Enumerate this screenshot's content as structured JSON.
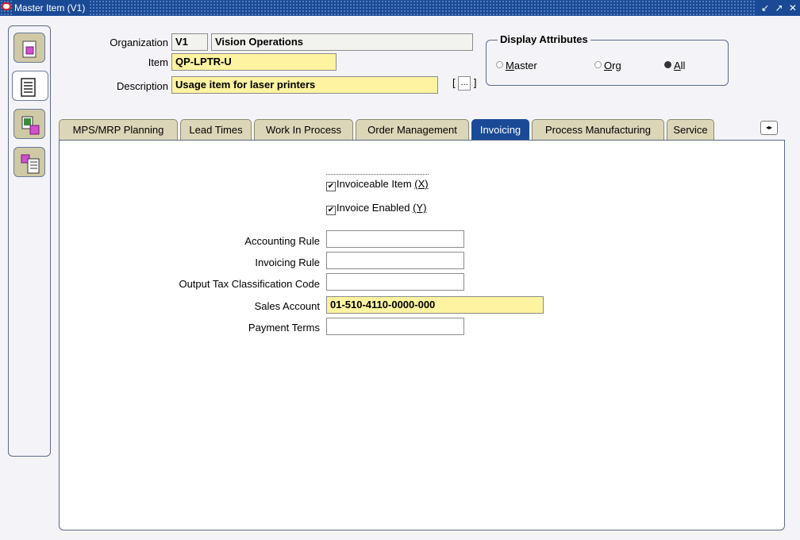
{
  "window": {
    "title": "Master Item (V1)",
    "controls": "↙ ↗ ✕"
  },
  "header": {
    "organization_label": "Organization",
    "organization_code": "V1",
    "organization_name": "Vision Operations",
    "item_label": "Item",
    "item_value": "QP-LPTR-U",
    "description_label": "Description",
    "description_value": "Usage item for laser printers",
    "flex_open": "[",
    "flex_close": "]",
    "flex_button": "..."
  },
  "display_attributes": {
    "title": "Display Attributes",
    "options": [
      {
        "label": "Master",
        "mnemonic": "M",
        "rest": "aster",
        "selected": false
      },
      {
        "label": "Org",
        "mnemonic": "O",
        "rest": "rg",
        "selected": false
      },
      {
        "label": "All",
        "mnemonic": "A",
        "rest": "ll",
        "selected": true
      }
    ]
  },
  "tabs": [
    {
      "label": "MPS/MRP Planning",
      "active": false
    },
    {
      "label": "Lead Times",
      "active": false
    },
    {
      "label": "Work In Process",
      "active": false
    },
    {
      "label": "Order Management",
      "active": false
    },
    {
      "label": "Invoicing",
      "active": true
    },
    {
      "label": "Process Manufacturing",
      "active": false
    },
    {
      "label": "Service",
      "active": false
    }
  ],
  "tab_scroll_icon": "◂▸",
  "invoicing": {
    "invoiceable_item": {
      "label": "Invoiceable Item",
      "key": "(X)",
      "checked": true
    },
    "invoice_enabled": {
      "label": "Invoice Enabled",
      "key": "(Y)",
      "checked": true
    },
    "accounting_rule": {
      "label": "Accounting Rule",
      "value": ""
    },
    "invoicing_rule": {
      "label": "Invoicing Rule",
      "value": ""
    },
    "output_tax": {
      "label": "Output Tax Classification Code",
      "value": ""
    },
    "sales_account": {
      "label": "Sales Account",
      "value": "01-510-4110-0000-000"
    },
    "payment_terms": {
      "label": "Payment Terms",
      "value": ""
    }
  },
  "check_mark": "✔",
  "colors": {
    "titlebar": "#1a4a96",
    "required_field": "#fdf3a0",
    "tab": "#dcd6b8",
    "active_tab": "#1a4a96"
  },
  "icons": [
    "oracle-logo-icon",
    "item-properties-icon",
    "list-icon",
    "item-catalog-icon",
    "item-categories-icon"
  ]
}
